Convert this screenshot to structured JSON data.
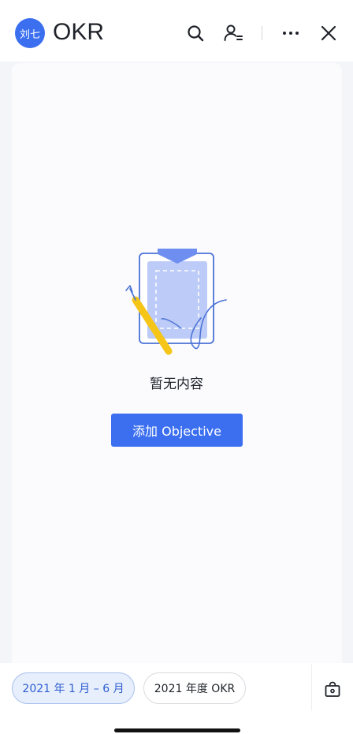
{
  "header": {
    "avatar_text": "刘七",
    "title": "OKR",
    "icons": [
      "search-icon",
      "user-list-icon",
      "more-icon",
      "close-icon"
    ]
  },
  "empty_state": {
    "message": "暂无内容",
    "button_label": "添加 Objective"
  },
  "footer": {
    "period_active": "2021 年 1 月 – 6 月",
    "period_other": "2021 年度 OKR",
    "icon": "bag-icon"
  },
  "colors": {
    "accent": "#3b6ff0",
    "background": "#f4f5f9",
    "illustration_light": "#bccbf7",
    "pencil": "#f5c518"
  }
}
